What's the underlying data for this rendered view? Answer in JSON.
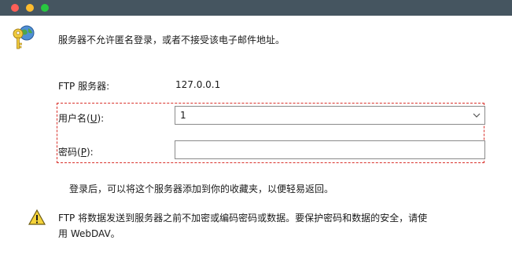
{
  "header": {
    "message": "服务器不允许匿名登录，或者不接受该电子邮件地址。"
  },
  "server": {
    "label": "FTP 服务器:",
    "value": "127.0.0.1"
  },
  "username": {
    "label_prefix": "用户名(",
    "label_accel": "U",
    "label_suffix": "):",
    "value": "1"
  },
  "password": {
    "label_prefix": "密码(",
    "label_accel": "P",
    "label_suffix": "):",
    "value": ""
  },
  "info": {
    "text": "登录后，可以将这个服务器添加到你的收藏夹，以便轻易返回。"
  },
  "warning": {
    "line1": "FTP 将数据发送到服务器之前不加密或编码密码或数据。要保护密码和数据的安全，请使",
    "line2": "用 WebDAV。"
  },
  "icons": {
    "key": "key-globe-icon",
    "warning": "warning-icon",
    "dropdown": "chevron-down-icon"
  },
  "colors": {
    "titlebar": "#455560",
    "close": "#ff5f57",
    "minimize": "#febc2e",
    "zoom": "#28c840",
    "highlight": "#d9302a"
  }
}
